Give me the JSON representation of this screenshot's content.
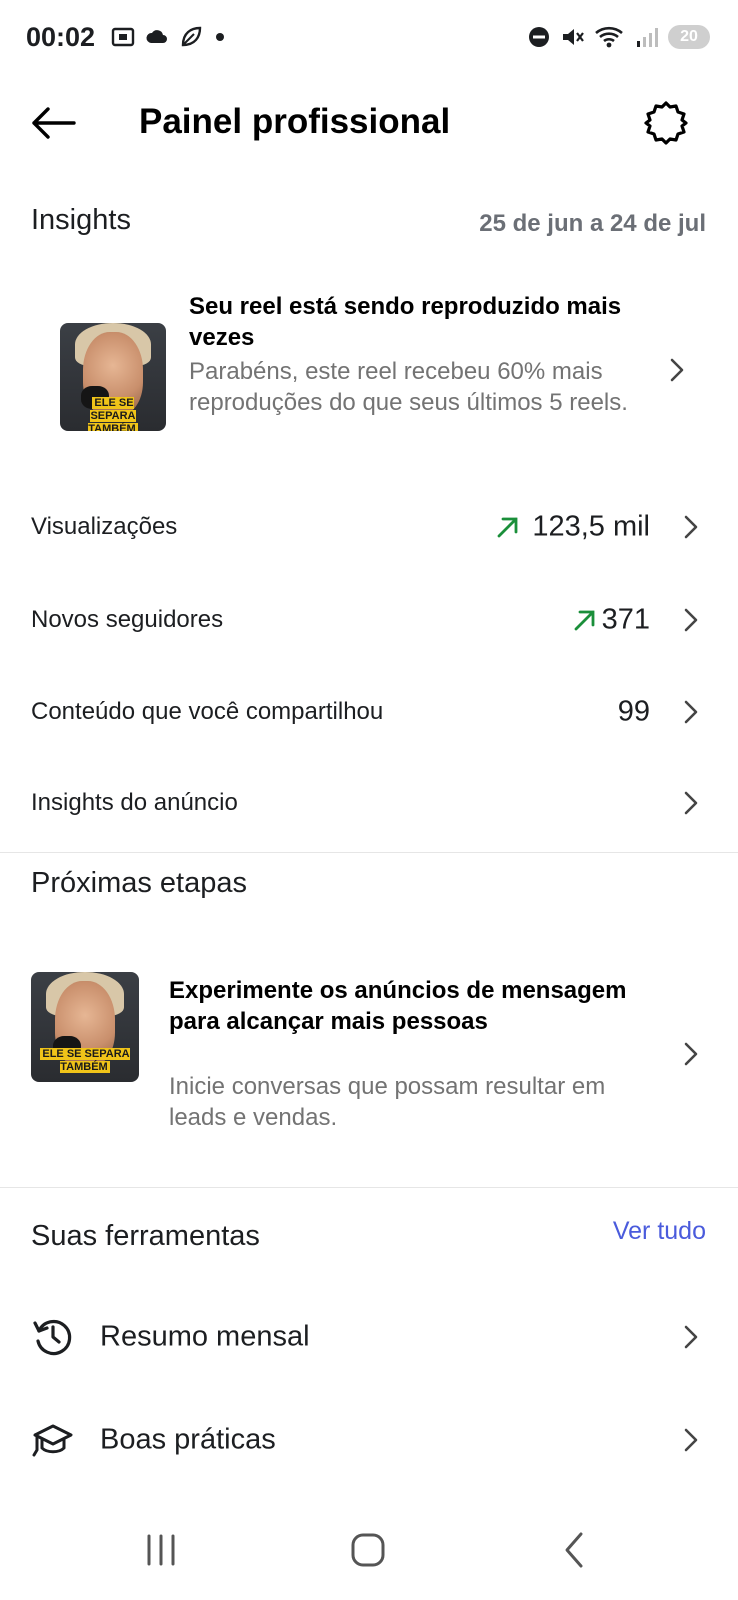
{
  "status_bar": {
    "time": "00:02",
    "battery": "20",
    "icons": [
      "screenshot-icon",
      "cloud-icon",
      "leaf-icon",
      "dot-icon",
      "do-not-disturb-icon",
      "mute-icon",
      "wifi-icon",
      "signal-icon"
    ]
  },
  "header": {
    "title": "Painel profissional",
    "back_icon": "arrow-left-icon",
    "settings_icon": "gear-icon"
  },
  "insights": {
    "title": "Insights",
    "date_range": "25 de jun a 24 de jul",
    "highlight_card": {
      "title": "Seu reel está sendo reproduzido mais vezes",
      "description": "Parabéns, este reel recebeu 60% mais reproduções do que seus últimos 5 reels.",
      "thumb_caption": "ELE SE SEPARA TAMBÉM"
    },
    "metrics": [
      {
        "label": "Visualizações",
        "value": "123,5 mil",
        "trend": "up"
      },
      {
        "label": "Novos seguidores",
        "value": "371",
        "trend": "up"
      },
      {
        "label": "Conteúdo que você compartilhou",
        "value": "99",
        "trend": "none"
      },
      {
        "label": "Insights do anúncio",
        "value": "",
        "trend": "none"
      }
    ]
  },
  "next_steps": {
    "title": "Próximas etapas",
    "card": {
      "title": "Experimente os anúncios de mensagem para alcançar mais pessoas",
      "description": "Inicie conversas que possam resultar em leads e vendas.",
      "thumb_caption": "ELE SE SEPARA TAMBÉM"
    }
  },
  "tools": {
    "title": "Suas ferramentas",
    "see_all": "Ver tudo",
    "items": [
      {
        "label": "Resumo mensal",
        "icon": "history-clock-icon"
      },
      {
        "label": "Boas práticas",
        "icon": "graduation-cap-icon"
      }
    ]
  },
  "nav": {
    "icons": [
      "recent-apps-icon",
      "home-icon",
      "back-icon"
    ]
  },
  "colors": {
    "trend_up": "#1a8f3a",
    "link": "#4a5bdc",
    "secondary_text": "#737373"
  }
}
